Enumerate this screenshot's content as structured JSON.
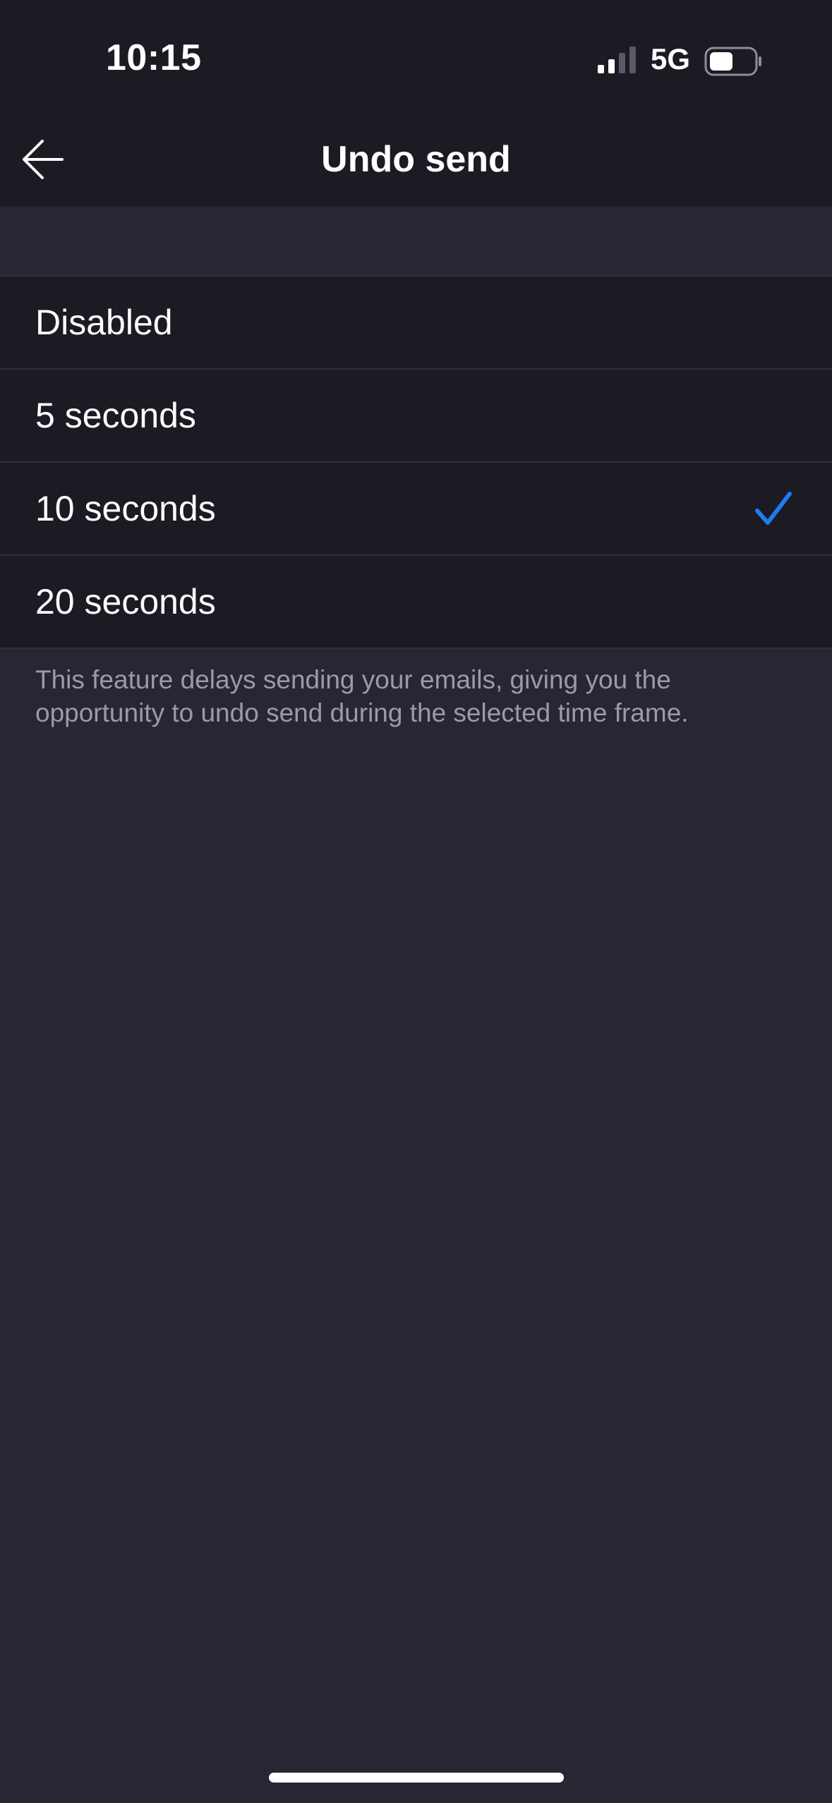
{
  "status_bar": {
    "time": "10:15",
    "network": "5G",
    "signal_icon": "cellular-signal-icon",
    "battery_icon": "battery-icon"
  },
  "nav": {
    "title": "Undo send",
    "back_icon": "arrow-left-icon"
  },
  "options": [
    {
      "label": "Disabled",
      "selected": false
    },
    {
      "label": "5 seconds",
      "selected": false
    },
    {
      "label": "10 seconds",
      "selected": true
    },
    {
      "label": "20 seconds",
      "selected": false
    }
  ],
  "footnote": "This feature delays sending your emails, giving you the opportunity to undo send during the selected time frame.",
  "colors": {
    "accent": "#1e7cf2",
    "background": "#272633",
    "surface": "#1c1b24",
    "secondary_text": "#9b9aa6"
  }
}
